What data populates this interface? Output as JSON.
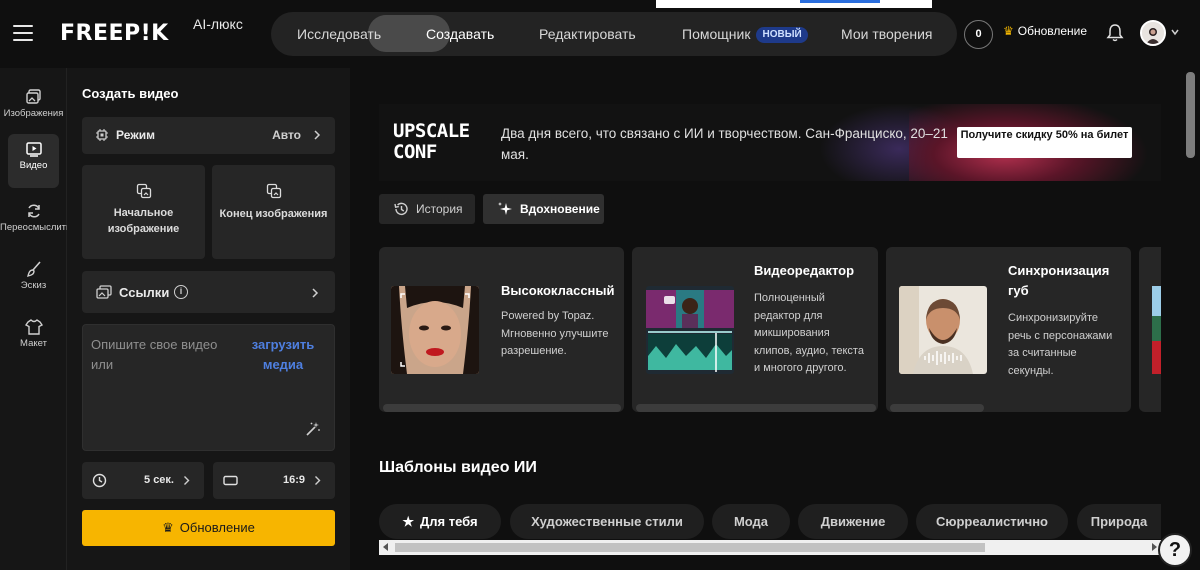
{
  "header": {
    "logo": "FREEP!K",
    "plan": "AI-люкс",
    "nav": [
      {
        "label": "Исследовать"
      },
      {
        "label": "Создавать"
      },
      {
        "label": "Редактировать"
      },
      {
        "label": "Помощник",
        "badge": "НОВЫЙ"
      },
      {
        "label": "Мои творения"
      }
    ],
    "credits": "0",
    "upgrade": "Обновление"
  },
  "rail": [
    {
      "label": "Изображения",
      "icon": "image-icon"
    },
    {
      "label": "Видео",
      "icon": "video-icon"
    },
    {
      "label": "Переосмыслить",
      "icon": "refresh-icon"
    },
    {
      "label": "Эскиз",
      "icon": "brush-icon"
    },
    {
      "label": "Макет",
      "icon": "mockup-icon"
    }
  ],
  "panel": {
    "title": "Создать видео",
    "mode_label": "Режим",
    "mode_value": "Авто",
    "start_image": "Начальное изображение",
    "end_image": "Конец изображения",
    "references": "Ссылки",
    "prompt_placeholder": "Опишите свое видео или",
    "prompt_upload": "загрузить медиа",
    "duration": "5 сек.",
    "ratio": "16:9",
    "upgrade": "Обновление"
  },
  "promo": {
    "logo_line1": "UPSCALE",
    "logo_line2": "CONF",
    "text": "Два дня всего, что связано с ИИ и творчеством. Сан-Франциско, 20–21 мая.",
    "cta": "Получите скидку 50% на билет"
  },
  "actions": {
    "history": "История",
    "inspiration": "Вдохновение"
  },
  "tools": [
    {
      "title": "Высококлассный",
      "desc": "Powered by Topaz. Мгновенно улучшите разрешение."
    },
    {
      "title": "Видеоредактор",
      "desc": "Полноценный редактор для микширования клипов, аудио, текста и многого другого."
    },
    {
      "title": "Синхронизация губ",
      "desc": "Синхронизируйте речь с персонажами за считанные секунды."
    }
  ],
  "templates": {
    "title": "Шаблоны видео ИИ",
    "chips": [
      "Для тебя",
      "Художественные стили",
      "Мода",
      "Движение",
      "Сюрреалистично",
      "Природа"
    ]
  },
  "help": "?",
  "colors": {
    "accent_yellow": "#f7b500",
    "link_blue": "#4e7fe0",
    "badge_blue": "#1e3a8a"
  }
}
